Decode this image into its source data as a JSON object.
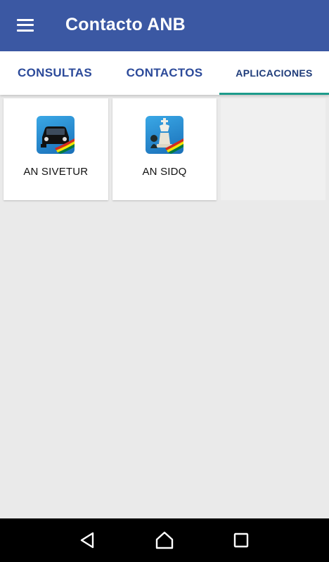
{
  "app_bar": {
    "title": "Contacto ANB",
    "menu_icon": "hamburger-menu-icon",
    "background_color": "#3b58a3"
  },
  "tabs": [
    {
      "label": "CONSULTAS",
      "selected": false
    },
    {
      "label": "CONTACTOS",
      "selected": false
    },
    {
      "label": "APLICACIONES",
      "selected": true
    }
  ],
  "accent_color": "#1d9b8b",
  "apps": [
    {
      "label": "AN SIVETUR",
      "icon": "car-app-icon"
    },
    {
      "label": "AN SIDQ",
      "icon": "chess-app-icon"
    }
  ],
  "navigation_bar": {
    "back_icon": "back-triangle-icon",
    "home_icon": "home-icon",
    "recents_icon": "recents-square-icon"
  }
}
